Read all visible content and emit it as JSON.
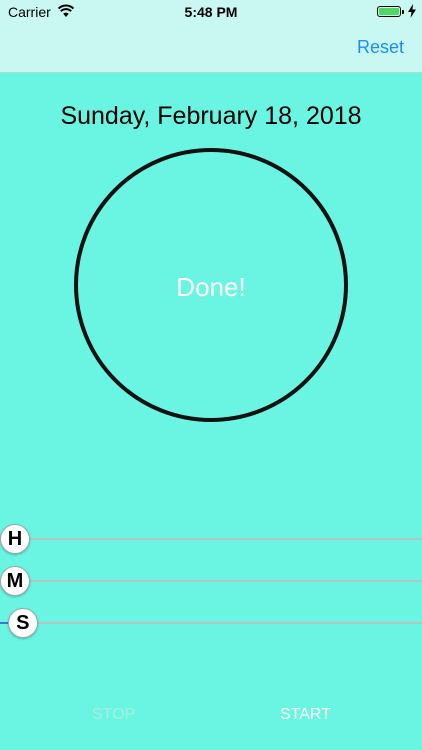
{
  "status_bar": {
    "carrier": "Carrier",
    "time": "5:48 PM",
    "battery_color": "#4cd964",
    "icons": [
      "wifi-icon",
      "battery-icon",
      "charging-bolt-icon"
    ]
  },
  "nav": {
    "reset_label": "Reset"
  },
  "main": {
    "date": "Sunday, February 18, 2018",
    "ring_text": "Done!"
  },
  "sliders": [
    {
      "label": "H",
      "value": 0.0
    },
    {
      "label": "M",
      "value": 0.0
    },
    {
      "label": "S",
      "value": 0.02
    }
  ],
  "controls": {
    "stop_label": "STOP",
    "start_label": "START"
  },
  "colors": {
    "background": "#69f5e1",
    "accent": "#1a8cff"
  }
}
